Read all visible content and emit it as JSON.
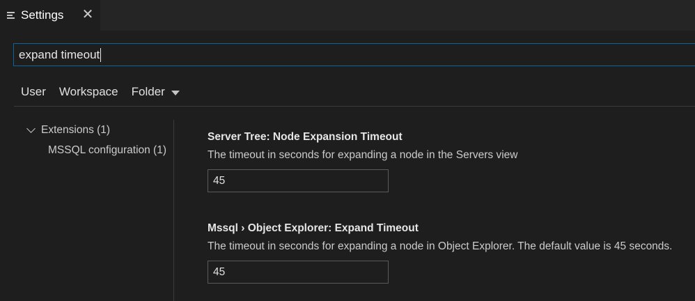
{
  "tab": {
    "title": "Settings",
    "close_icon": "close-icon",
    "icon": "settings-editor-icon"
  },
  "search": {
    "value": "expand timeout"
  },
  "scopes": {
    "user": "User",
    "workspace": "Workspace",
    "folder": "Folder"
  },
  "toc": {
    "group_label": "Extensions (1)",
    "child_label": "MSSQL configuration (1)"
  },
  "settings": [
    {
      "title": "Server Tree: Node Expansion Timeout",
      "description": "The timeout in seconds for expanding a node in the Servers view",
      "value": "45"
    },
    {
      "title": "Mssql › Object Explorer: Expand Timeout",
      "description": "The timeout in seconds for expanding a node in Object Explorer. The default value is 45 seconds.",
      "value": "45"
    }
  ],
  "colors": {
    "focus_border": "#0e639c",
    "background": "#1e1e1e",
    "tabbar": "#252526"
  }
}
